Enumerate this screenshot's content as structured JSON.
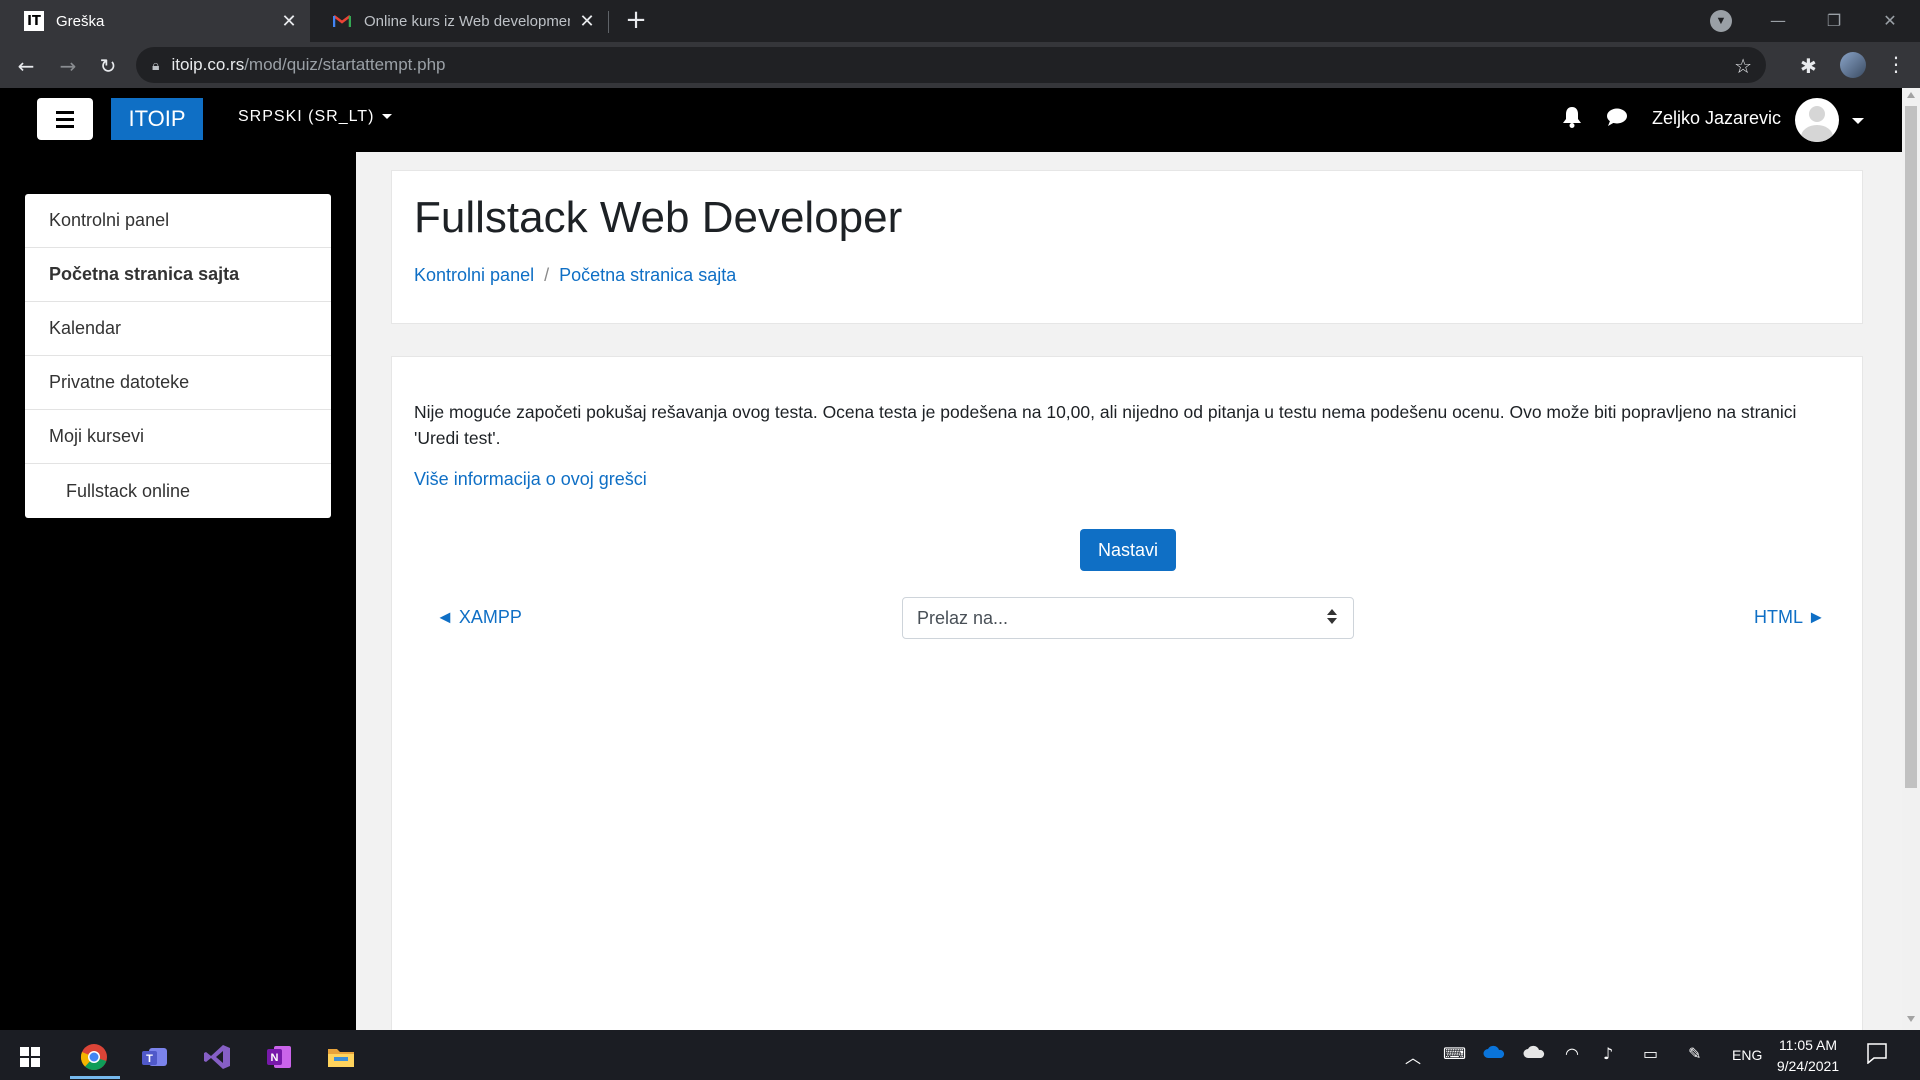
{
  "browser": {
    "tabs": [
      {
        "title": "Greška",
        "favicon": "IT",
        "active": true
      },
      {
        "title": "Online kurs iz Web development",
        "favicon": "gmail-icon",
        "active": false
      }
    ],
    "url_host": "itoip.co.rs",
    "url_path": "/mod/quiz/startattempt.php"
  },
  "navbar": {
    "brand": "ITOIP",
    "language": "SRPSKI (SR_LT)",
    "user_name": "Zeljko Jazarevic"
  },
  "drawer": {
    "items": [
      {
        "label": "Kontrolni panel"
      },
      {
        "label": "Početna stranica sajta"
      },
      {
        "label": "Kalendar"
      },
      {
        "label": "Privatne datoteke"
      },
      {
        "label": "Moji kursevi"
      },
      {
        "label": "Fullstack online"
      }
    ]
  },
  "header": {
    "title": "Fullstack Web Developer",
    "breadcrumb": [
      "Kontrolni panel",
      "Početna stranica sajta"
    ]
  },
  "content": {
    "error_message": "Nije moguće započeti pokušaj rešavanja ovog testa. Ocena testa je podešena na 10,00, ali nijedno od pitanja u testu nema podešenu ocenu. Ovo može biti popravljeno na stranici 'Uredi test'.",
    "more_info_link": "Više informacija o ovoj grešci",
    "continue_button": "Nastavi",
    "prev_activity": "◄ XAMPP",
    "next_activity": "HTML ►",
    "jump_select": "Prelaz na..."
  },
  "taskbar": {
    "language": "ENG",
    "time": "11:05 AM",
    "date": "9/24/2021"
  },
  "colors": {
    "brand": "#0f6fc5",
    "navbar": "#000000",
    "page_bg": "#f2f2f2"
  }
}
